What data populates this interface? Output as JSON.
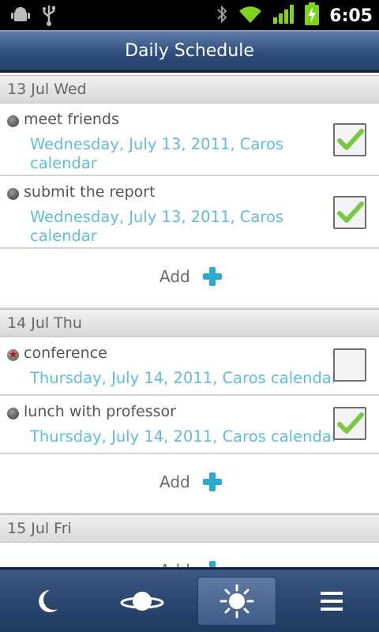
{
  "status_bar": {
    "time": "6:05",
    "icons": [
      "android-debug-icon",
      "usb-icon",
      "bluetooth-icon",
      "wifi-icon",
      "signal-icon",
      "battery-charging-icon"
    ]
  },
  "header": {
    "title": "Daily Schedule"
  },
  "days": [
    {
      "label": "13 Jul Wed",
      "events": [
        {
          "title": "meet friends",
          "subtitle": "Wednesday, July 13, 2011, Caros calendar",
          "checked": true,
          "important": false
        },
        {
          "title": "submit the report",
          "subtitle": "Wednesday, July 13, 2011, Caros calendar",
          "checked": true,
          "important": false
        }
      ],
      "add_label": "Add"
    },
    {
      "label": "14 Jul Thu",
      "events": [
        {
          "title": "conference",
          "subtitle": "Thursday, July 14, 2011, Caros calendar",
          "checked": false,
          "important": true
        },
        {
          "title": "lunch with professor",
          "subtitle": "Thursday, July 14, 2011, Caros calendar",
          "checked": true,
          "important": false
        }
      ],
      "add_label": "Add"
    },
    {
      "label": "15 Jul Fri",
      "events": [],
      "add_label": "Add"
    }
  ],
  "tab_bar": {
    "tabs": [
      {
        "icon": "moon-icon",
        "active": false
      },
      {
        "icon": "planet-icon",
        "active": false
      },
      {
        "icon": "sun-icon",
        "active": true
      },
      {
        "icon": "menu-icon",
        "active": false
      }
    ]
  },
  "colors": {
    "accent": "#5ebde0",
    "add_plus": "#2aa9d4",
    "header_bar": "#2f4e7c",
    "important_star": "#cc1111"
  }
}
